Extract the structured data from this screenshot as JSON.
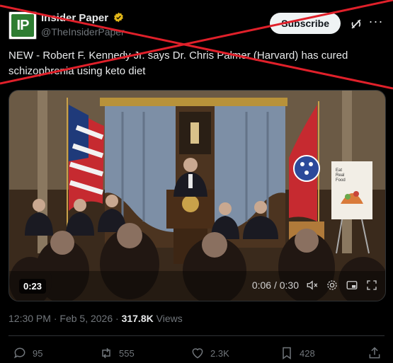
{
  "account": {
    "display_name": "Insider Paper",
    "handle": "@TheInsiderPaper",
    "avatar_letters": "IP",
    "verified_icon": "verified-badge-icon",
    "brand_color": "#2e7d32",
    "badge_color": "#e2b719"
  },
  "header": {
    "subscribe_label": "Subscribe",
    "more_icon": "more-icon",
    "more_glyph": "···"
  },
  "tweet": {
    "text": "NEW - Robert F. Kennedy Jr. says Dr. Chris Palmer (Harvard) has cured schizophrenia using keto diet"
  },
  "media": {
    "duration": "0:23",
    "timecode": "0:06 / 0:30",
    "sign_lines": [
      "Eat",
      "Real",
      "Food"
    ],
    "icons": [
      "mute-icon",
      "settings-icon",
      "pip-icon",
      "fullscreen-icon"
    ]
  },
  "meta": {
    "time": "12:30 PM",
    "separator1": "·",
    "date": "Feb 5, 2026",
    "separator2": "·",
    "views_count": "317.8K",
    "views_label": "Views"
  },
  "actions": {
    "replies": "95",
    "reposts": "555",
    "likes": "2.3K",
    "bookmarks": "428"
  },
  "overlay": {
    "cross_color": "#e0202a",
    "icon": "red-x-overlay"
  }
}
